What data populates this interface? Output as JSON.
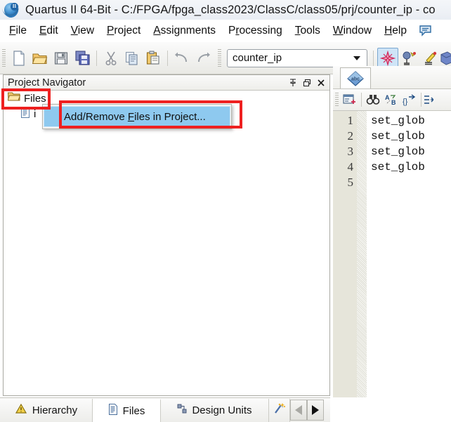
{
  "window": {
    "title": "Quartus II 64-Bit - C:/FPGA/fpga_class2023/ClassC/class05/prj/counter_ip - co",
    "logo_icon": "quartus-logo-icon"
  },
  "menubar": {
    "items": [
      {
        "label": "File",
        "mnemonic": "F"
      },
      {
        "label": "Edit",
        "mnemonic": "E"
      },
      {
        "label": "View",
        "mnemonic": "V"
      },
      {
        "label": "Project",
        "mnemonic": "P"
      },
      {
        "label": "Assignments",
        "mnemonic": "A"
      },
      {
        "label": "Processing",
        "mnemonic": "r"
      },
      {
        "label": "Tools",
        "mnemonic": "T"
      },
      {
        "label": "Window",
        "mnemonic": "W"
      },
      {
        "label": "Help",
        "mnemonic": "H"
      }
    ],
    "search_icon": "speech-bubble-search-icon"
  },
  "toolbar": {
    "buttons": [
      {
        "name": "new-file-icon",
        "title": "New"
      },
      {
        "name": "open-project-icon",
        "title": "Open"
      },
      {
        "name": "save-file-icon",
        "title": "Save"
      },
      {
        "name": "save-all-icon",
        "title": "Save All"
      },
      {
        "name": "cut-icon",
        "title": "Cut"
      },
      {
        "name": "copy-icon",
        "title": "Copy"
      },
      {
        "name": "paste-icon",
        "title": "Paste"
      },
      {
        "name": "undo-icon",
        "title": "Undo"
      },
      {
        "name": "redo-icon",
        "title": "Redo"
      }
    ],
    "project_combo": {
      "value": "counter_ip",
      "placeholder": "counter_ip",
      "dropdown_icon": "chevron-down-icon"
    },
    "right_buttons": [
      {
        "name": "compilation-star-icon",
        "active": true
      },
      {
        "name": "pin-planner-icon",
        "active": false
      },
      {
        "name": "assignment-editor-icon",
        "active": false
      },
      {
        "name": "settings-blue-icon",
        "active": false
      }
    ]
  },
  "project_navigator": {
    "title": "Project Navigator",
    "window_buttons": [
      {
        "name": "pin-icon",
        "glyph": "pin"
      },
      {
        "name": "restore-icon",
        "glyph": "restore"
      },
      {
        "name": "close-icon",
        "glyph": "close"
      }
    ],
    "tree": [
      {
        "label": "Files",
        "icon": "folder-open-icon",
        "level": 0,
        "highlighted": true
      },
      {
        "label": "i",
        "icon": "file-document-icon",
        "level": 1,
        "highlighted": false
      }
    ],
    "tabs": [
      {
        "label": "Hierarchy",
        "icon": "hierarchy-triangle-icon",
        "selected": false
      },
      {
        "label": "Files",
        "icon": "files-document-icon",
        "selected": true
      },
      {
        "label": "Design Units",
        "icon": "design-units-icon",
        "selected": false
      },
      {
        "label": "",
        "icon": "ip-catalog-wand-icon",
        "selected": false
      }
    ],
    "nav_prev_icon": "arrow-left-icon",
    "nav_next_icon": "arrow-right-icon"
  },
  "context_menu": {
    "items": [
      {
        "label_before": "Add/Remove ",
        "mnemonic": "F",
        "label_after": "iles in Project...",
        "highlighted": true
      }
    ]
  },
  "annotations": {
    "color": "#ee2020",
    "boxes": [
      "files-tree-node",
      "add-remove-files-menu-item"
    ]
  },
  "editor": {
    "tab_icon": "abc-text-file-icon",
    "toolbar_buttons": [
      {
        "name": "insert-template-icon"
      },
      {
        "name": "find-binoculars-icon"
      },
      {
        "name": "replace-ab-icon"
      },
      {
        "name": "go-to-line-icon"
      },
      {
        "name": "increase-indent-icon"
      }
    ],
    "line_numbers": [
      "1",
      "2",
      "3",
      "4",
      "5"
    ],
    "lines": [
      "set_glob",
      "set_glob",
      "set_glob",
      "set_glob",
      ""
    ]
  }
}
